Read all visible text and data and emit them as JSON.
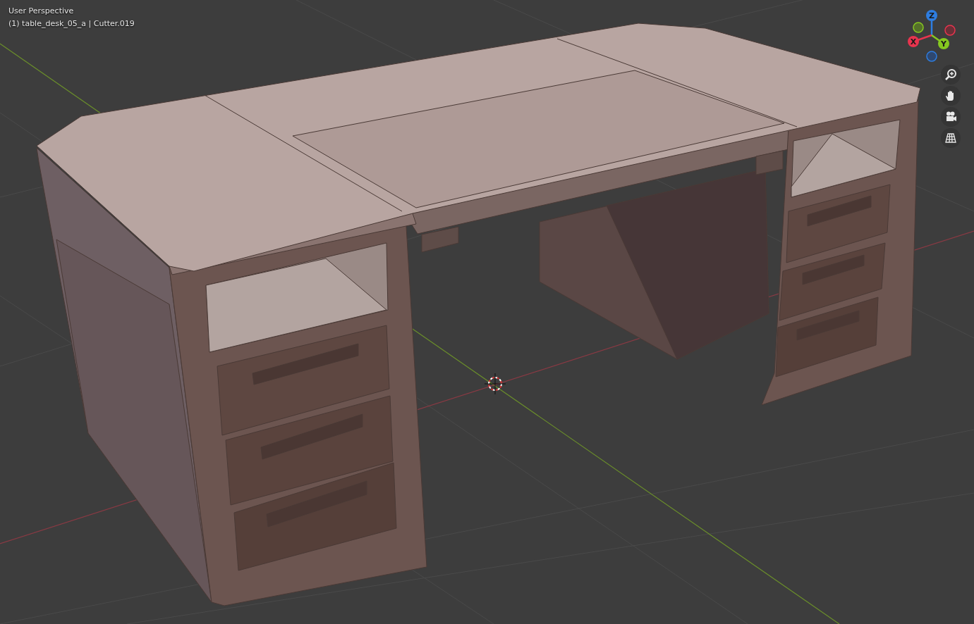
{
  "viewport_header": {
    "view_name": "User Perspective",
    "object_info": "(1) table_desk_05_a | Cutter.019"
  },
  "axis_gizmo": [
    {
      "label": "Z",
      "color": "#2e7de0"
    },
    {
      "label": "X",
      "color": "#e8344e"
    },
    {
      "label": "Y",
      "color": "#86c820"
    }
  ],
  "navigation_buttons": [
    {
      "kind": "zoom"
    },
    {
      "kind": "pan"
    },
    {
      "kind": "camera"
    },
    {
      "kind": "ortho"
    }
  ]
}
